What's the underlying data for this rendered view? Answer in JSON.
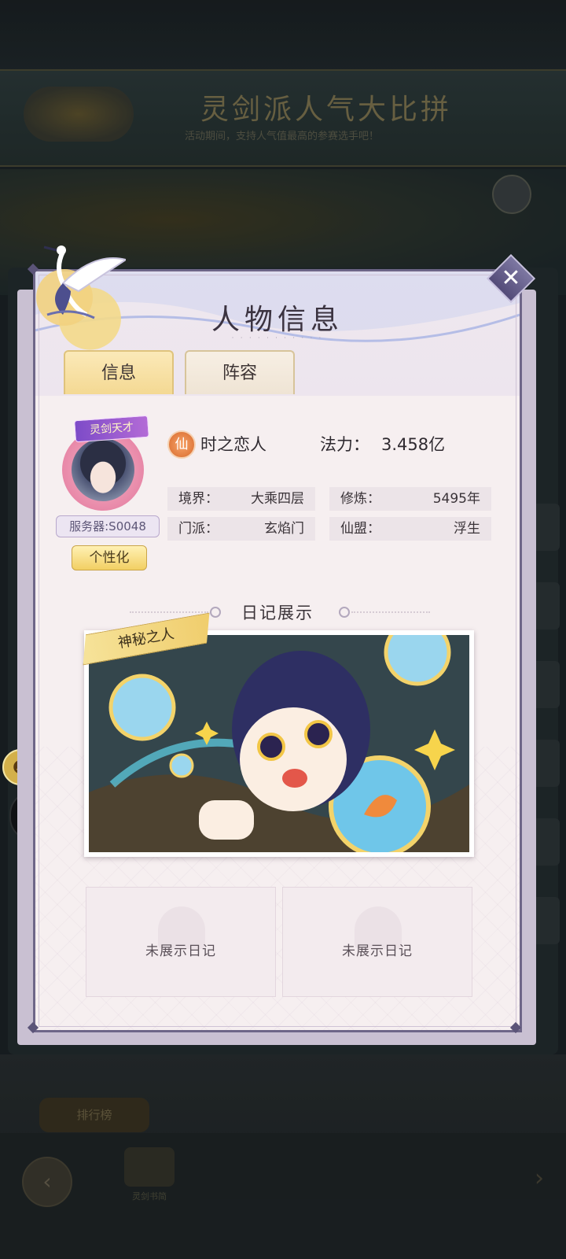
{
  "background": {
    "banner_title": "灵剑派人气大比拼",
    "banner_subtitle": "活动期间，支持人气值最高的参赛选手吧！",
    "bottom_button": "排行榜",
    "bottom_item": "灵剑书简"
  },
  "dialog": {
    "title": "人物信息",
    "close_icon": "close-icon",
    "tabs": [
      {
        "label": "信息",
        "active": true
      },
      {
        "label": "阵容",
        "active": false
      }
    ]
  },
  "profile": {
    "avatar_badge": "灵剑天才",
    "server": "服务器:S0048",
    "personalize_button": "个性化",
    "xian_icon_char": "仙",
    "name": "时之恋人",
    "power_label": "法力：",
    "power_value": "3.458亿",
    "stats": [
      {
        "key": "境界：",
        "value": "大乘四层"
      },
      {
        "key": "修炼：",
        "value": "5495年"
      },
      {
        "key": "门派：",
        "value": "玄焰门"
      },
      {
        "key": "仙盟：",
        "value": "浮生"
      }
    ]
  },
  "diary": {
    "section_title": "日记展示",
    "featured_tag": "神秘之人",
    "empty_slots": [
      "未展示日记",
      "未展示日记"
    ]
  },
  "colors": {
    "accent_gold": "#f4d993",
    "frame_purple": "#6e6688",
    "panel_bg": "#f6eff0"
  }
}
